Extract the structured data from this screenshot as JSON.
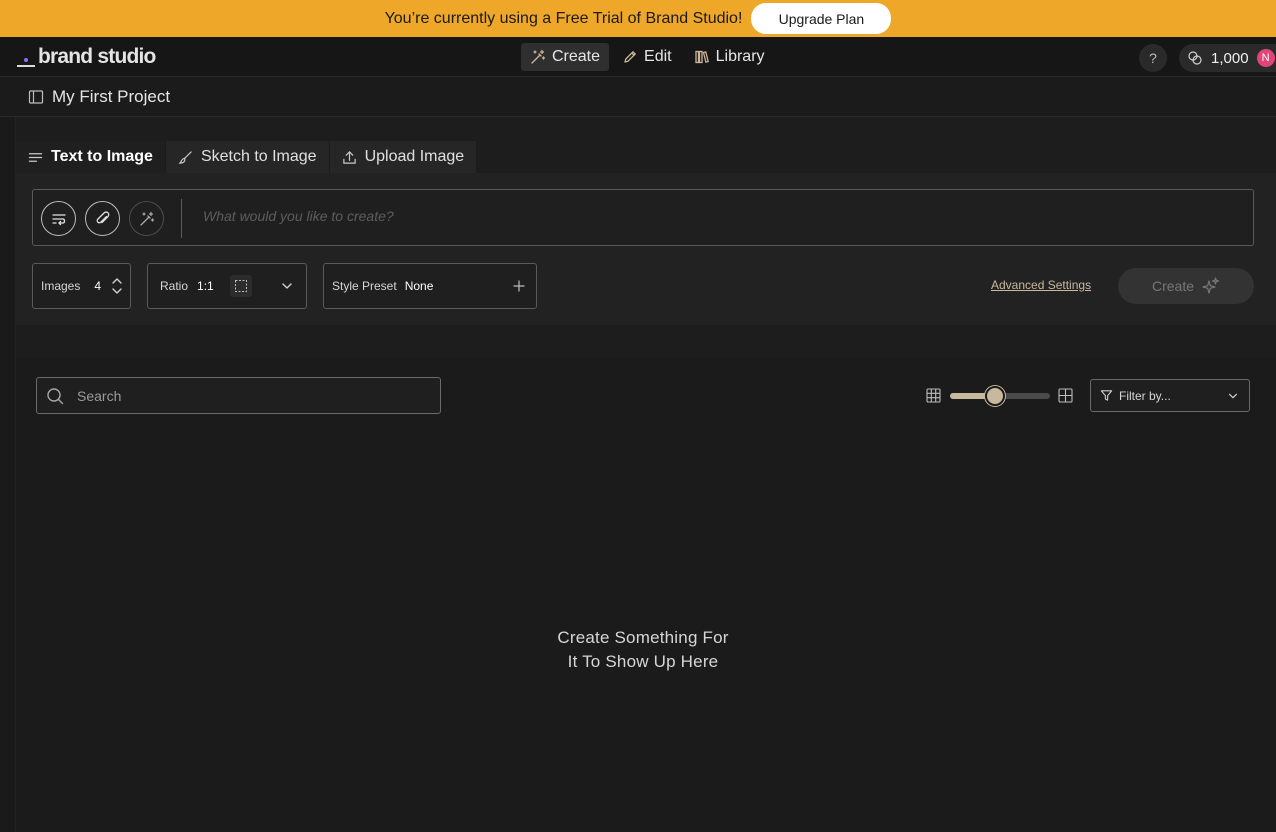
{
  "banner": {
    "text": "You’re currently using a Free Trial of Brand Studio!",
    "upgrade_label": "Upgrade Plan"
  },
  "topnav": {
    "logo_text": "brand studio",
    "tabs": [
      {
        "label": "Create",
        "icon": "magic-wand-icon",
        "active": true
      },
      {
        "label": "Edit",
        "icon": "pencil-icon",
        "active": false
      },
      {
        "label": "Library",
        "icon": "books-icon",
        "active": false
      }
    ],
    "help_label": "?",
    "credits": "1,000",
    "avatar_initial": "N"
  },
  "project": {
    "title": "My First Project"
  },
  "mode_tabs": [
    {
      "label": "Text to Image",
      "icon": "lines-icon",
      "active": true
    },
    {
      "label": "Sketch to Image",
      "icon": "brush-icon",
      "active": false
    },
    {
      "label": "Upload Image",
      "icon": "upload-icon",
      "active": false
    }
  ],
  "prompt": {
    "placeholder": "What would you like to create?",
    "value": ""
  },
  "controls": {
    "images_label": "Images",
    "images_value": "4",
    "ratio_label": "Ratio",
    "ratio_value": "1:1",
    "style_label": "Style Preset",
    "style_value": "None",
    "advanced_label": "Advanced Settings",
    "create_label": "Create"
  },
  "library": {
    "search_placeholder": "Search",
    "search_value": "",
    "grid_size_level": 0.45,
    "filter_placeholder": "Filter by...",
    "empty_line1": "Create Something For",
    "empty_line2": "It To Show Up Here"
  },
  "colors": {
    "banner": "#efa72a",
    "accent": "#c8b99e",
    "logo_dot": "#8b6cff",
    "avatar": "#e0457a",
    "background": "#1b1b1b"
  }
}
